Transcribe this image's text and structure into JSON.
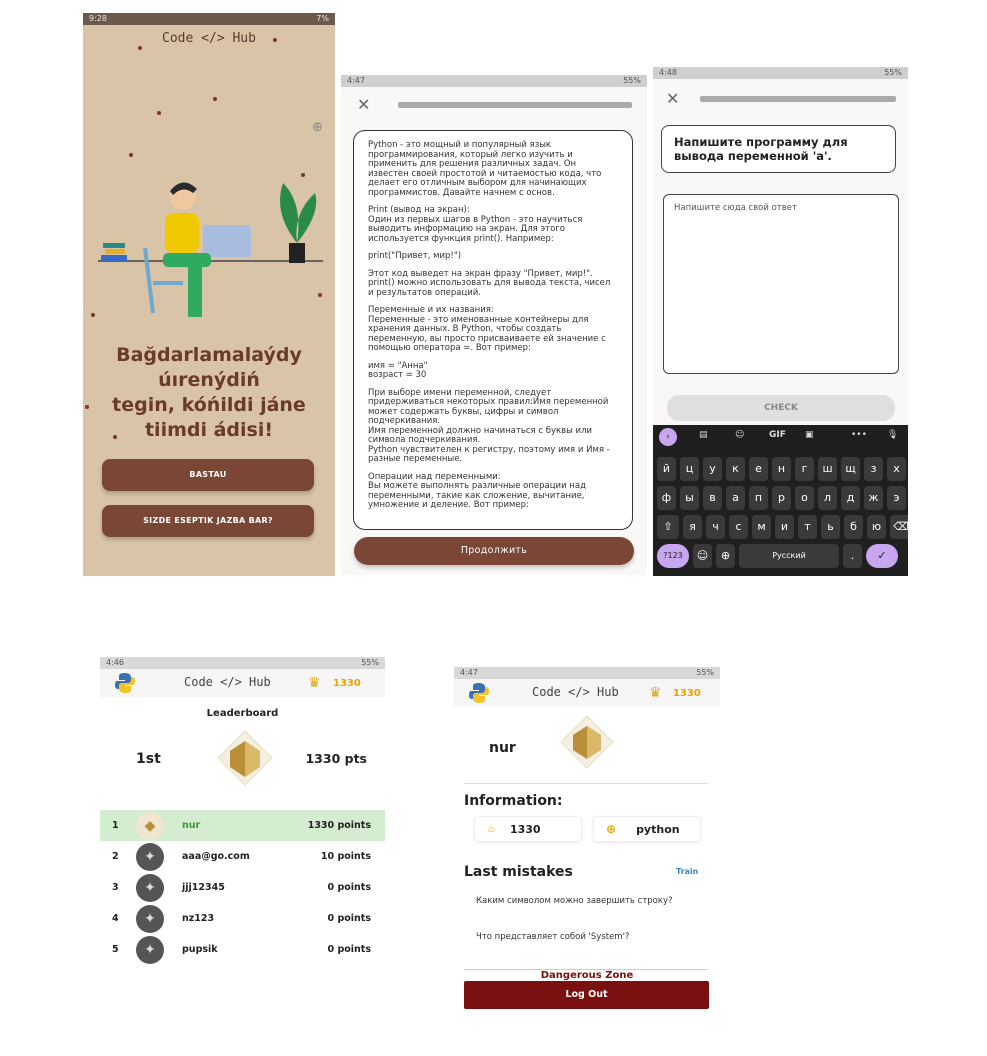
{
  "screen1": {
    "status_time": "9:28",
    "status_right": "7%",
    "logo": "Code </> Hub",
    "headline": [
      "Bağdarlamalaýdy",
      "úırenýdiń",
      "tegin, kóńildi jáne",
      "tiimdi ádisi!"
    ],
    "start_button": "BASTAU",
    "account_button": "SIZDE ESEPTIK JAZBA BAR?"
  },
  "screen2": {
    "status_time": "4:47",
    "status_right": "55%",
    "lesson_paragraphs": [
      "Python - это мощный и популярный язык программирования, который легко изучить и применить для решения различных задач. Он известен своей простотой и читаемостью кода, что делает его отличным выбором для начинающих программистов. Давайте начнем с основ.",
      "Print (вывод на экран):\nОдин из первых шагов в Python - это научиться выводить информацию на экран. Для этого используется функция print(). Например:",
      "print(\"Привет, мир!\")",
      "Этот код выведет на экран фразу \"Привет, мир!\". print() можно использовать для вывода текста, чисел и результатов операций.",
      "Переменные и их названия:\nПеременные - это именованные контейнеры для хранения данных. В Python, чтобы создать переменную, вы просто присваиваете ей значение с помощью оператора =. Вот пример:",
      "имя = \"Анна\"\nвозраст = 30",
      "При выборе имени переменной, следует придерживаться некоторых правил:Имя переменной может содержать буквы, цифры и символ подчеркивания.\nИмя переменной должно начинаться с буквы или символа подчеркивания.\nPython чувствителен к регистру, поэтому имя и Имя - разные переменные.",
      "Операции над переменными:\nВы можете выполнять различные операции над переменными, такие как сложение, вычитание, умножение и деление. Вот пример:"
    ],
    "continue_button": "Продолжить"
  },
  "screen3": {
    "status_time": "4:48",
    "status_right": "55%",
    "question": "Напишите программу для вывода переменной 'а'.",
    "answer_placeholder": "Напишите сюда свой ответ",
    "check_button": "CHECK",
    "keyboard": {
      "row1": [
        "й",
        "ц",
        "у",
        "к",
        "е",
        "н",
        "г",
        "ш",
        "щ",
        "з",
        "х"
      ],
      "row2": [
        "ф",
        "ы",
        "в",
        "а",
        "п",
        "р",
        "о",
        "л",
        "д",
        "ж",
        "э"
      ],
      "row3": [
        "я",
        "ч",
        "с",
        "м",
        "и",
        "т",
        "ь",
        "б",
        "ю"
      ],
      "gif": "GIF",
      "num_key": "?123",
      "space_label": "Русский"
    }
  },
  "screen4": {
    "status_time": "4:46",
    "status_right": "55%",
    "logo": "Code </> Hub",
    "points": "1330",
    "title": "Leaderboard",
    "place": "1st",
    "place_points": "1330 pts",
    "rows": [
      {
        "rank": "1",
        "name": "nur",
        "points": "1330 points"
      },
      {
        "rank": "2",
        "name": "aaa@go.com",
        "points": "10 points"
      },
      {
        "rank": "3",
        "name": "jjj12345",
        "points": "0 points"
      },
      {
        "rank": "4",
        "name": "nz123",
        "points": "0 points"
      },
      {
        "rank": "5",
        "name": "pupsik",
        "points": "0 points"
      }
    ],
    "highlight_color": "#d4ecd0"
  },
  "screen5": {
    "status_time": "4:47",
    "status_right": "55%",
    "logo": "Code </> Hub",
    "points": "1330",
    "username": "nur",
    "info_title": "Information:",
    "info_points": "1330",
    "info_language": "python",
    "mistakes_title": "Last mistakes",
    "train_link": "Train",
    "mistakes": [
      "Каким символом можно завершить строку?",
      "Что представляет собой 'System'?"
    ],
    "danger_title": "Dangerous Zone",
    "logout_button": "Log Out",
    "danger_color": "#7a1010"
  }
}
